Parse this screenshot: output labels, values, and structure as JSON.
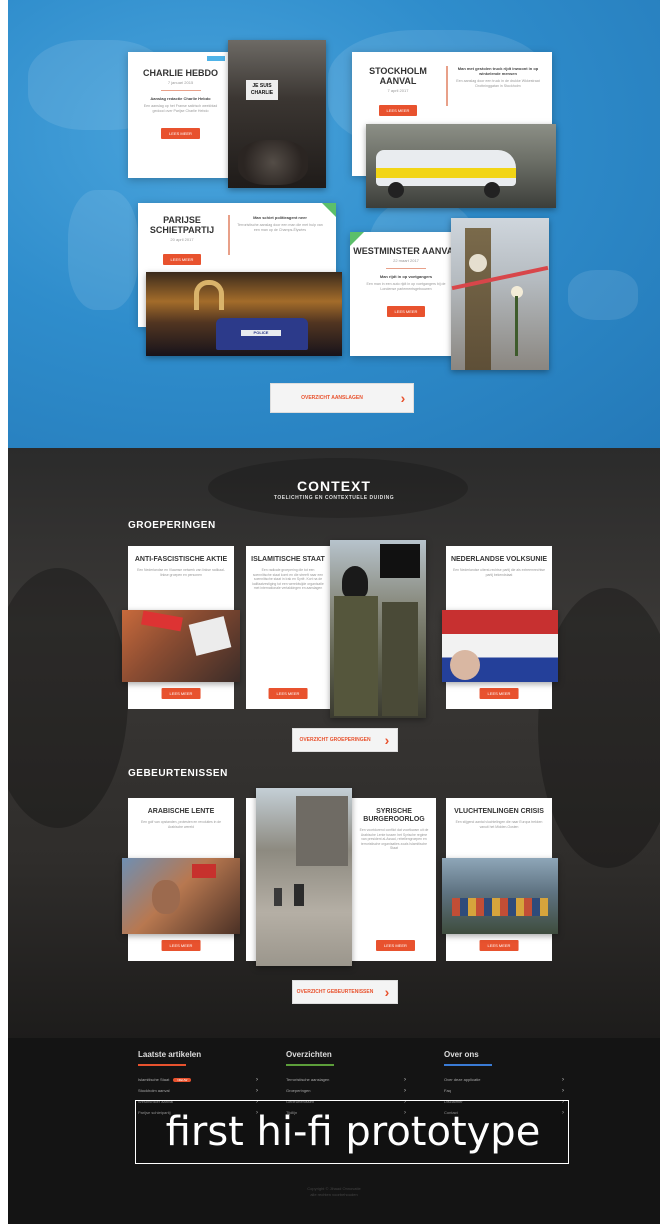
{
  "attacks": {
    "charlie": {
      "title": "CHARLIE HEBDO",
      "date": "7 januari 2015",
      "subtitle": "Aanslag redactie Charlie Hebdo",
      "text": "Een aanslag op het Franse satirisch weekblad gedood over Parijse Charlie Hebdo",
      "button": "LEES MEER"
    },
    "stockholm": {
      "title": "STOCKHOLM AANVAL",
      "date": "7 april 2017",
      "subtitle": "Man met gestolen truck rijdt inwoont in op winkelende mensen",
      "text": "Een aanslag door een truck in de drukke Wkkestraat Drottninggatan in Stockholm",
      "button": "LEES MEER"
    },
    "paris": {
      "title": "PARIJSE SCHIETPARTIJ",
      "date": "20 april 2017",
      "subtitle": "Man schiet politieagent neer",
      "text": "Terroristische aanslag door een man die met hulp van een man op de Champs-Élysées",
      "button": "LEES MEER"
    },
    "westminster": {
      "title": "WESTMINSTER AANVAL",
      "date": "22 maart 2017",
      "subtitle": "Man rijdt in op voetgangers",
      "text": "Een man in een auto rijdt in op voetgangers bij de Londense parlementsgebouwen",
      "button": "LEES MEER"
    }
  },
  "hero_overview_button": "OVERZICHT AANSLAGEN",
  "context": {
    "title": "CONTEXT",
    "subtitle": "TOELICHTING EN CONTEXTUELE DUIDING",
    "groups_heading": "GROEPERINGEN",
    "events_heading": "GEBEURTENISSEN",
    "groups": [
      {
        "title": "ANTI-FASCISTISCHE AKTIE",
        "text": "Een Nederlandse en Vlaamse netwerk van linkse radikaal-linkse groepen en personen",
        "button": "LEES MEER"
      },
      {
        "title": "ISLAMITISCHE STAAT",
        "text": "Een radicale groepering die tot een soennitische staat komt en die streeft naar een soennitische staat in Irak en Syrië. Kort na de kalifaatvestiging tot een wereldwijde organisatie met internationale vertakkingen en aanslagen",
        "button": "LEES MEER"
      },
      {
        "title": "NEDERLANDSE VOLKSUNIE",
        "text": "Een Nederlandse uiterst-rechtse partij die als extreemrechtse partij bekendstaat",
        "button": "LEES MEER"
      }
    ],
    "groups_overview_button": "OVERZICHT GROEPERINGEN",
    "events": [
      {
        "title": "ARABISCHE LENTE",
        "text": "Een golf van opstanden, protesten en revoluties in de Arabische wereld",
        "button": "LEES MEER"
      },
      {
        "title": "SYRISCHE BURGEROORLOG",
        "text": "Een voortdurend conflict dat voortkwam uit de Arabische Lente tussen het Syrische regime van president al-Assad, rebellengroepen en terroristische organisaties zoals Islamitische Staat",
        "button": "LEES MEER"
      },
      {
        "title": "VLUCHTENLINGEN CRISIS",
        "text": "Een stijgend aantal vluchtelingen die naar Europa trekken vanuit het Midden-Oosten",
        "button": "LEES MEER"
      }
    ],
    "events_overview_button": "OVERZICHT GEBEURTENISSEN"
  },
  "footer": {
    "columns": [
      {
        "heading": "Laatste artikelen",
        "accent": "#e8522e",
        "items": [
          "Islamitische Staat",
          "Stockholm aanval",
          "Westminster aanval",
          "Parijse schietpartij"
        ],
        "badge": "NIEUW"
      },
      {
        "heading": "Overzichten",
        "accent": "#5c9e3a",
        "items": [
          "Terroristische aanslagen",
          "Groeperingen",
          "Gebeurtenissen",
          "Tijdlijn"
        ]
      },
      {
        "heading": "Over ons",
        "accent": "#3a7bd5",
        "items": [
          "Over deze applicatie",
          "Faq",
          "Disclaimer",
          "Contact"
        ]
      }
    ],
    "copyright_line1": "Copyright © Jihaad Onnovatie",
    "copyright_line2": "alle rechten voorbehouden"
  },
  "caption": "first hi-fi prototype",
  "colors": {
    "accent_orange": "#e8522e",
    "hero_blue": "#2f8dcc",
    "tag_green": "#5cbf6a",
    "tag_blue": "#4fb3e8"
  }
}
